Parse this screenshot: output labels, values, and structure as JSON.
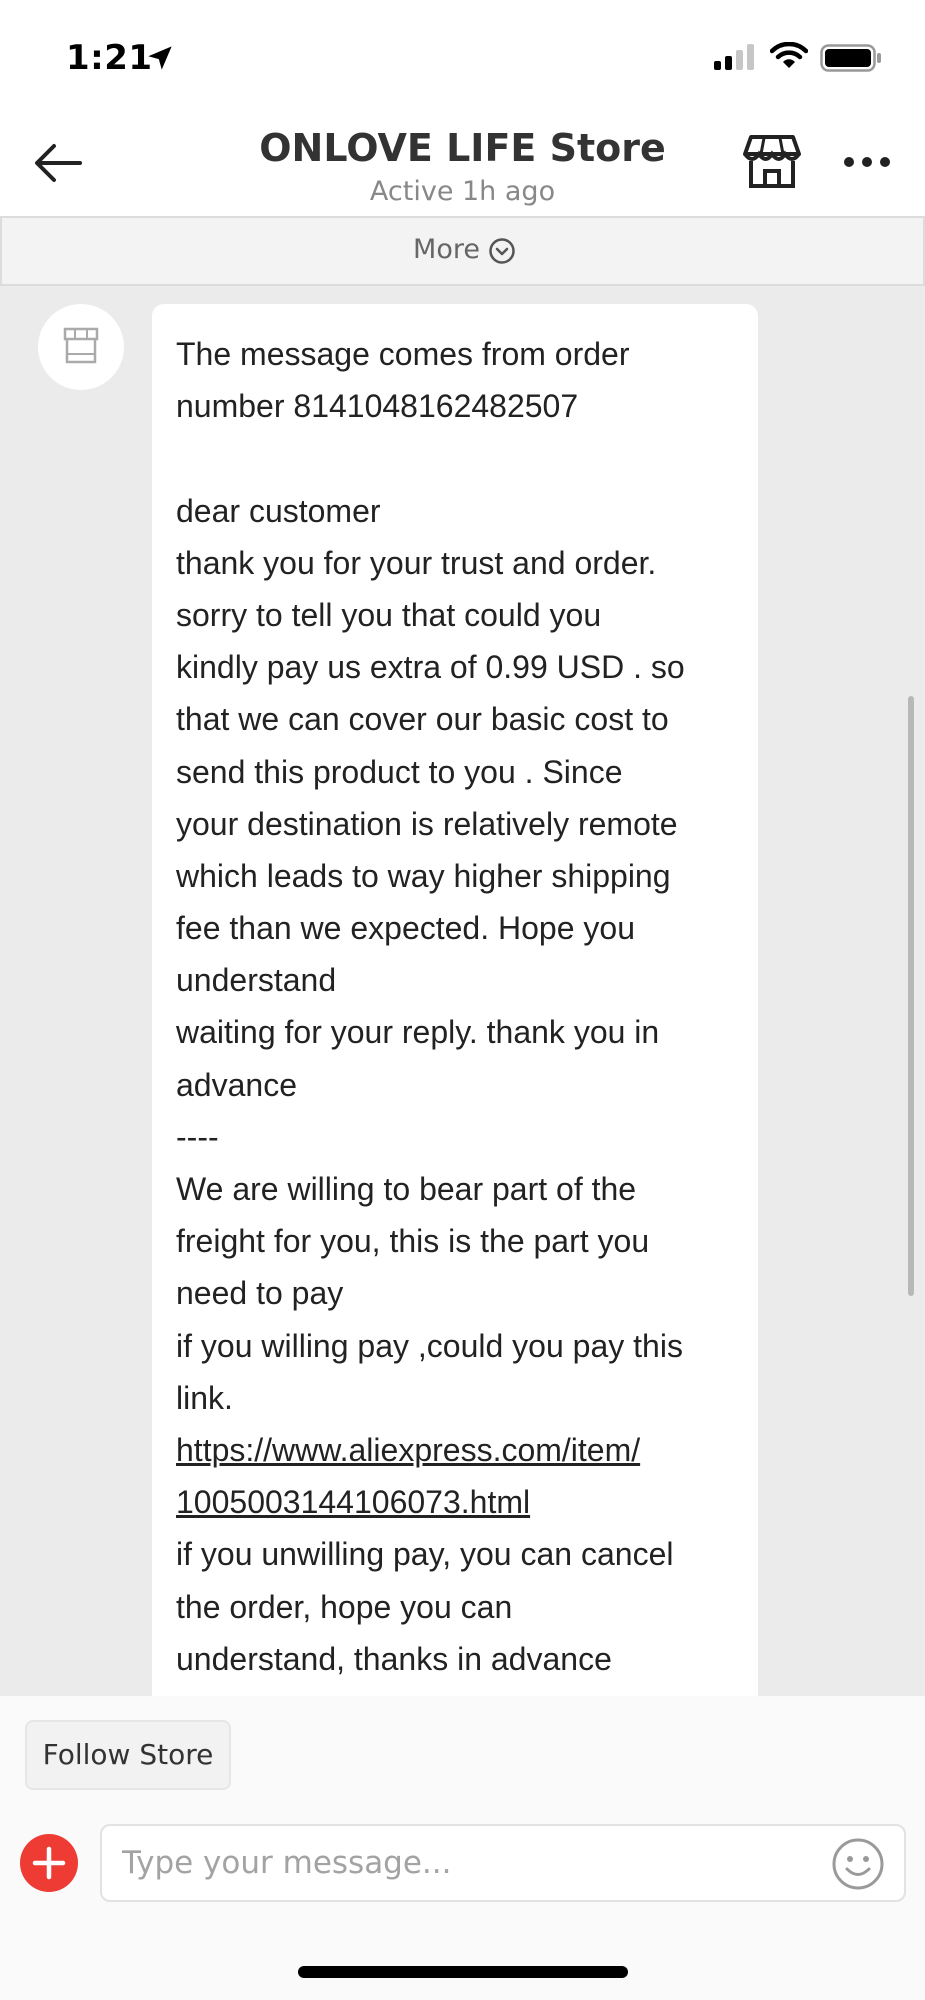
{
  "status_bar": {
    "time": "1:21"
  },
  "header": {
    "title": "ONLOVE LIFE Store",
    "subtitle": "Active 1h ago",
    "back_icon": "arrow-left-icon",
    "store_icon": "storefront-icon",
    "menu_icon": "more-horizontal-icon"
  },
  "more_bar": {
    "label": "More",
    "icon": "chevron-down-circle-icon"
  },
  "message": {
    "lines": [
      "The message comes from order",
      "number 8141048162482507",
      "",
      "dear customer",
      "thank you for your trust and order.",
      "sorry to tell you that could you",
      "kindly pay us extra of 0.99 USD . so",
      "that we can cover our basic cost to",
      "send this product to you . Since",
      "your destination is relatively remote",
      "which leads to way higher shipping",
      "fee than we expected. Hope you",
      "understand",
      "waiting for your reply. thank you in",
      "advance",
      "----",
      "We are willing to bear part of the",
      "freight for you, this is the part you",
      "need to pay",
      "if you willing pay ,could you pay this",
      "link."
    ],
    "link_lines": [
      "https://www.aliexpress.com/item/",
      "1005003144106073.html"
    ],
    "tail_lines": [
      "if you unwilling pay, you can cancel",
      "the order, hope you can",
      "understand, thanks in advance"
    ]
  },
  "footer": {
    "follow_label": "Follow Store",
    "input_placeholder": "Type your message...",
    "add_icon": "plus-circle-icon",
    "emoji_icon": "smiley-icon"
  },
  "colors": {
    "accent": "#ee3b34",
    "chat_background": "#ebebeb",
    "text": "#222222"
  }
}
